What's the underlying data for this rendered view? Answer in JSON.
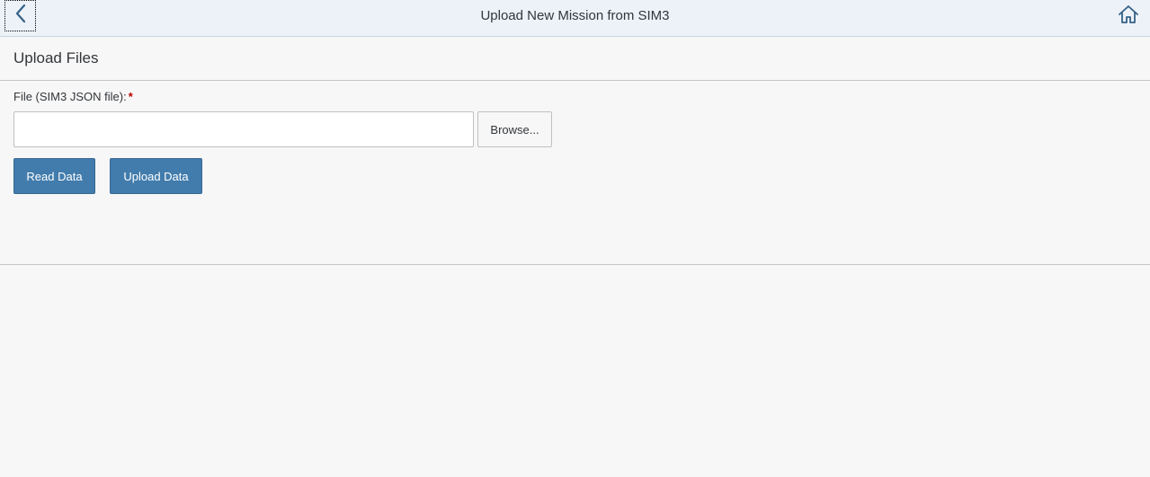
{
  "header": {
    "title": "Upload New Mission from SIM3",
    "back_icon": "chevron-left-icon",
    "home_icon": "home-icon"
  },
  "section": {
    "title": "Upload Files"
  },
  "file_field": {
    "label": "File (SIM3 JSON file):",
    "required_marker": "*",
    "value": "",
    "browse_label": "Browse..."
  },
  "actions": {
    "read_label": "Read Data",
    "upload_label": "Upload Data"
  },
  "colors": {
    "header_bg": "#edf2f8",
    "primary_button": "#427cac",
    "required": "#bb0000",
    "icon": "#346187"
  }
}
